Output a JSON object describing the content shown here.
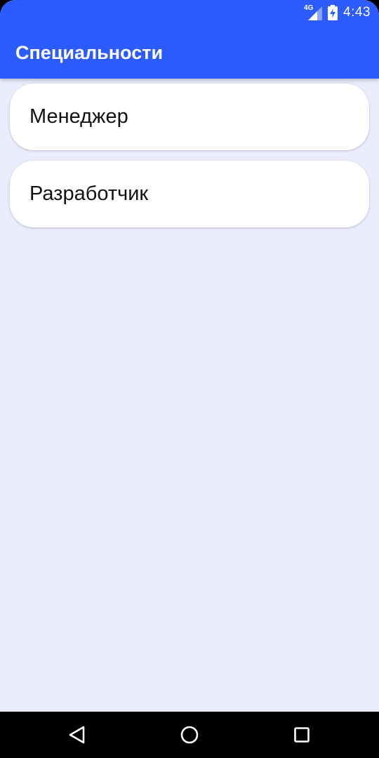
{
  "status_bar": {
    "network_label": "4G",
    "time": "4:43",
    "icons": [
      "signal-icon",
      "battery-charging-icon"
    ]
  },
  "app_bar": {
    "title": "Специальности",
    "color": "#2c5cff"
  },
  "list": {
    "items": [
      {
        "label": "Менеджер"
      },
      {
        "label": "Разработчик"
      }
    ]
  },
  "navigation_bar": {
    "icons": [
      "back-icon",
      "home-icon",
      "recents-icon"
    ]
  },
  "colors": {
    "background": "#ebedfe",
    "card": "#ffffff",
    "nav_bar": "#000000"
  }
}
